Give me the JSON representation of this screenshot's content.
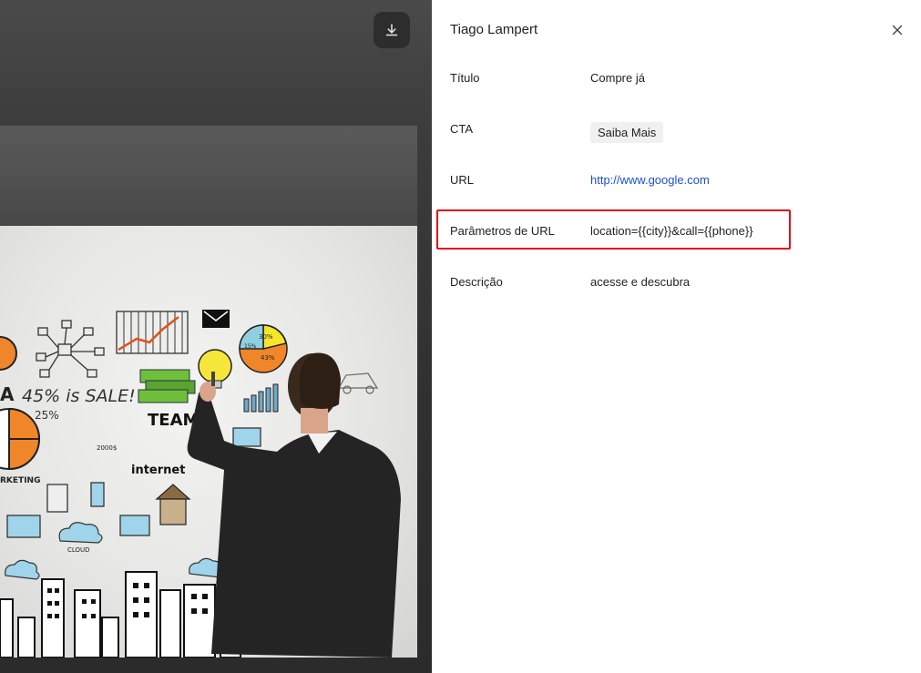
{
  "viewer": {
    "download_icon": "download-icon",
    "ad_image_text": {
      "sale": "45% is SALE!",
      "team": "TEAM",
      "internet": "internet",
      "cloud": "CLOUD",
      "pct25": "25%",
      "pie_a": "30%",
      "pie_b": "15%",
      "pie_c": "43%",
      "price": "2000$",
      "marketing": "RKETING",
      "fragment_a": "A"
    }
  },
  "panel": {
    "title": "Tiago Lampert",
    "close_icon": "close-icon",
    "fields": [
      {
        "label": "Título",
        "value": "Compre já"
      },
      {
        "label": "CTA",
        "value": "Saiba Mais"
      },
      {
        "label": "URL",
        "value": "http://www.google.com"
      },
      {
        "label": "Parâmetros de URL",
        "value": "location={{city}}&call={{phone}}"
      },
      {
        "label": "Descrição",
        "value": "acesse e descubra"
      }
    ],
    "highlight_color": "#e0101a",
    "link_color": "#1a4fd6"
  }
}
